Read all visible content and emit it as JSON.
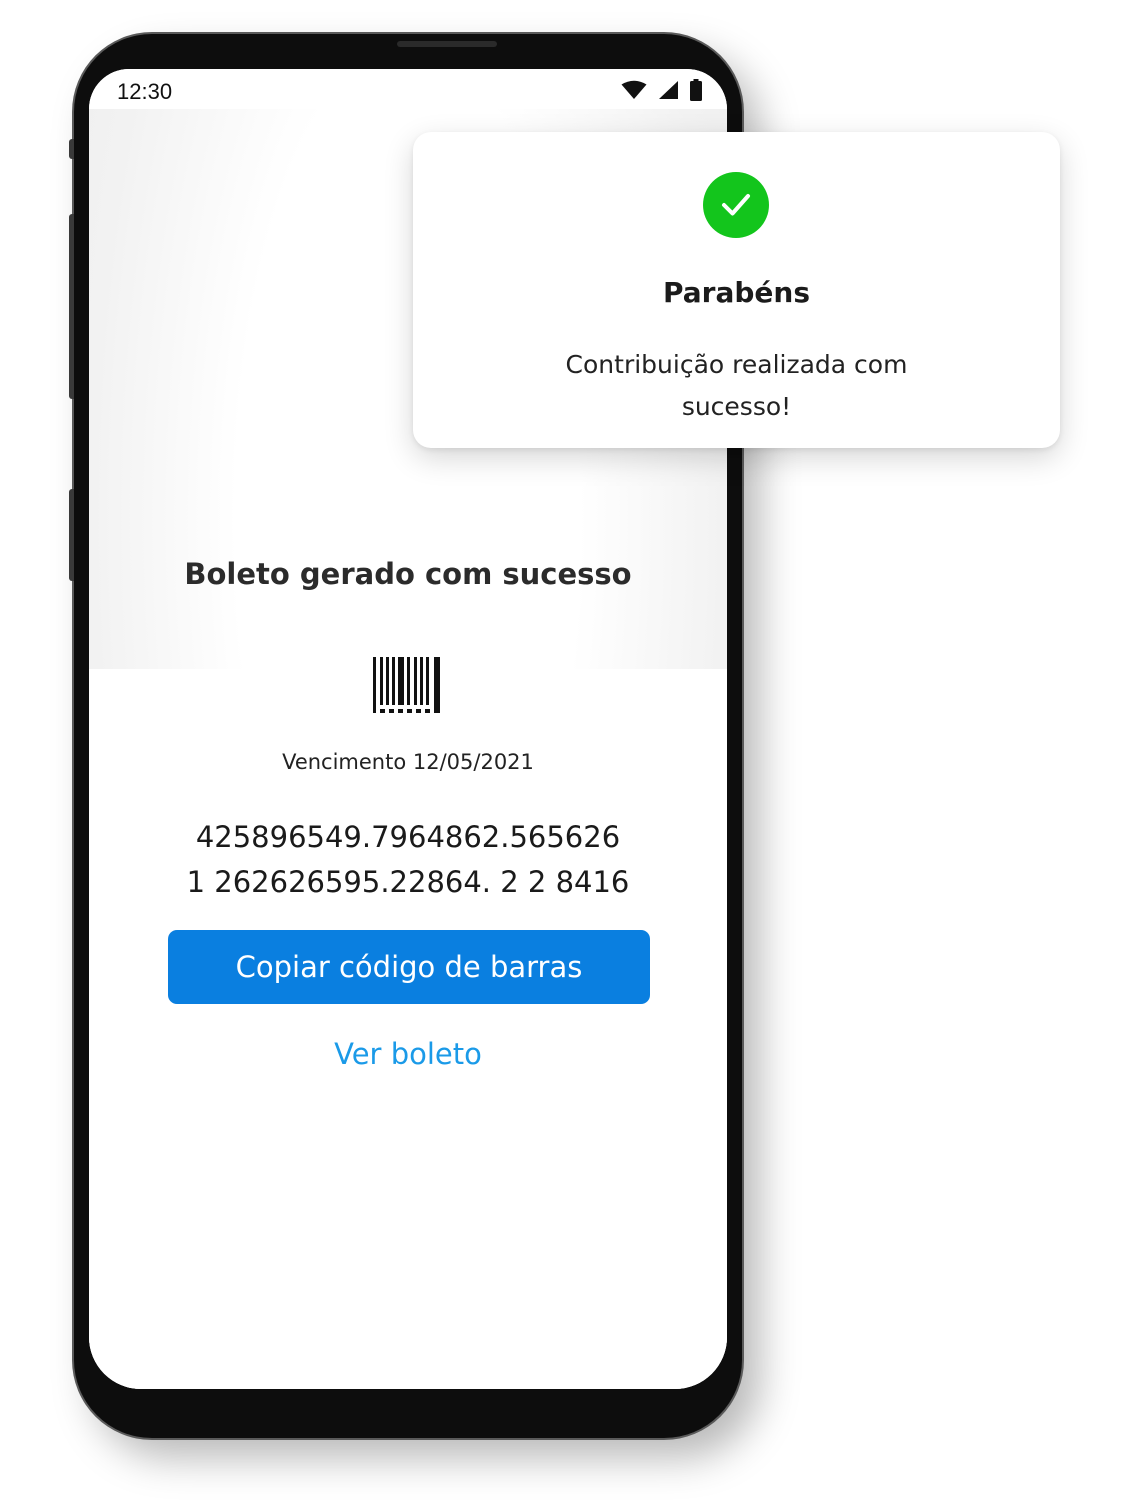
{
  "status_bar": {
    "time": "12:30",
    "icons": [
      "wifi-icon",
      "signal-icon",
      "battery-icon"
    ]
  },
  "boleto": {
    "title": "Boleto gerado com sucesso",
    "barcode_icon": "barcode-icon",
    "due_date": "Vencimento 12/05/2021",
    "code_line1": "425896549.7964862.565626",
    "code_line2": "1 262626595.22864. 2 2 8416",
    "copy_button_label": "Copiar código de barras",
    "view_link_label": "Ver boleto"
  },
  "toast": {
    "icon": "check-circle-icon",
    "title": "Parabéns",
    "message": "Contribuição realizada com sucesso!"
  },
  "colors": {
    "primary_button": "#0a7fe0",
    "link": "#1a9ae8",
    "success": "#13c51c"
  }
}
